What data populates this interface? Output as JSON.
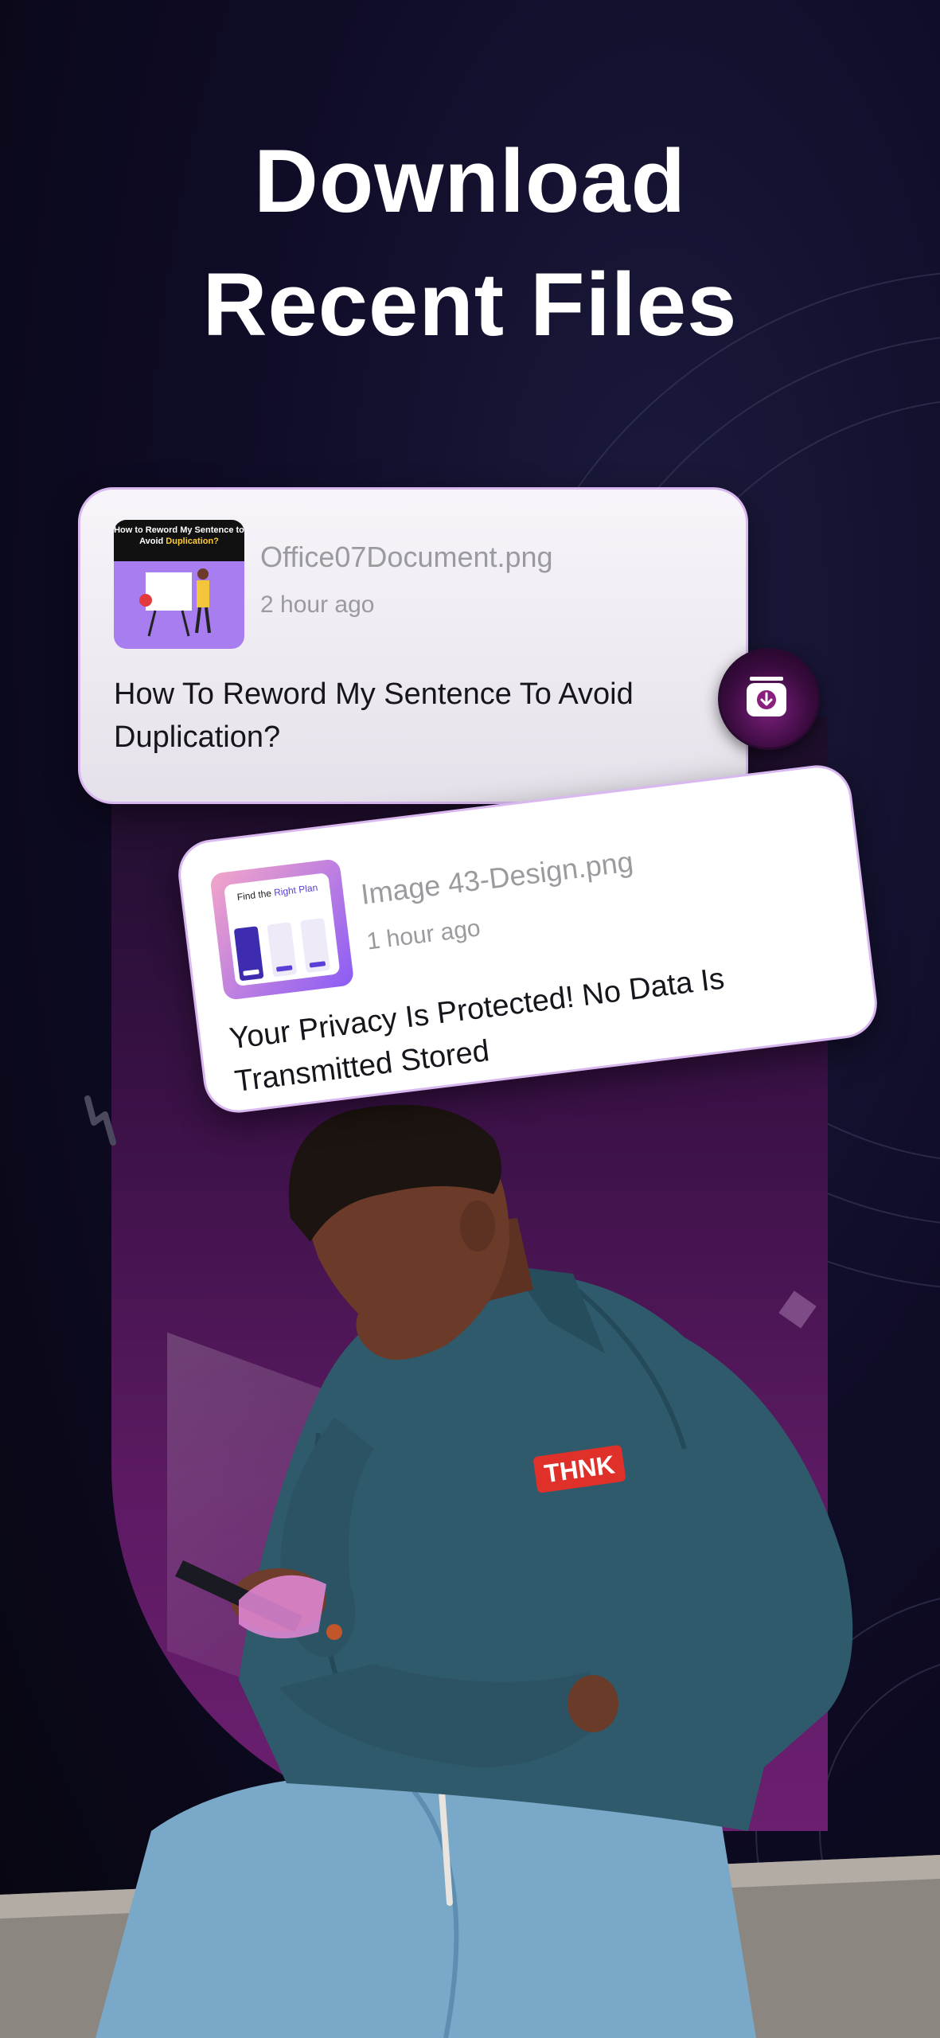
{
  "headline": {
    "line1": "Download",
    "line2": "Recent Files"
  },
  "cards": [
    {
      "file_name": "Office07Document.png",
      "time_ago": "2 hour ago",
      "description_line1": "How To Reword My Sentence To Avoid",
      "description_line2": "Duplication?",
      "thumbnail": {
        "line1": "How to Reword My Sentence to",
        "line2_plain": "Avoid ",
        "line2_highlight": "Duplication?"
      }
    },
    {
      "file_name": "Image 43-Design.png",
      "time_ago": "1 hour ago",
      "description_line1": "Your Privacy Is Protected! No Data Is",
      "description_line2": "Transmitted Stored",
      "thumbnail": {
        "title_plain": "Find the ",
        "title_highlight": "Right Plan"
      }
    }
  ],
  "download_button": {
    "icon": "download-icon"
  },
  "shirt_text": "THNK",
  "colors": {
    "background": "#0f0c28",
    "panel_purple": "#5d1a63",
    "card_border": "#d9b8f0",
    "accent_button": "#7a1f7c",
    "shirt_teal": "#2f5a6b",
    "thnk_red": "#e0302a"
  }
}
